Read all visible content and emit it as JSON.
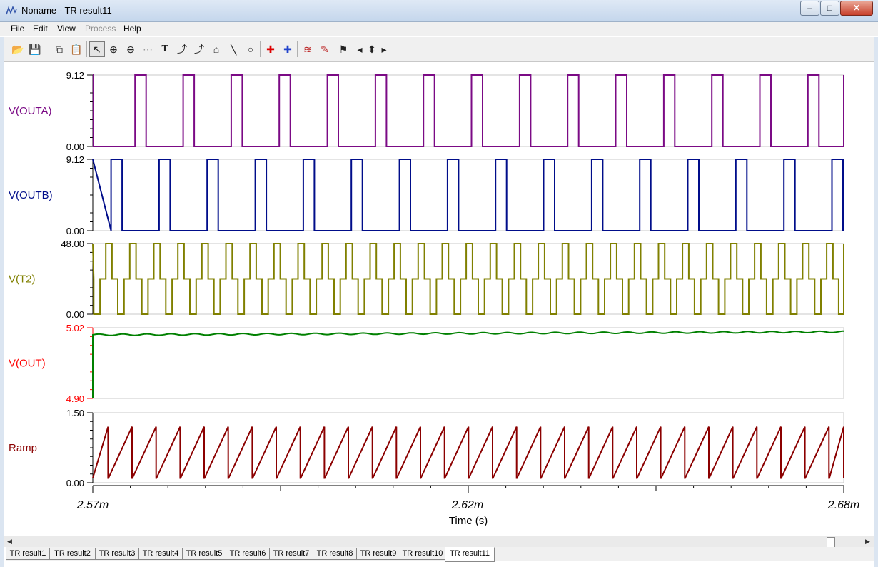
{
  "window": {
    "title": "Noname - TR result11",
    "minimize_glyph": "–",
    "maximize_glyph": "□",
    "close_glyph": "✕"
  },
  "menu": [
    {
      "label": "File",
      "enabled": true
    },
    {
      "label": "Edit",
      "enabled": true
    },
    {
      "label": "View",
      "enabled": true
    },
    {
      "label": "Process",
      "enabled": false
    },
    {
      "label": "Help",
      "enabled": true
    }
  ],
  "toolbar": {
    "buttons": [
      {
        "name": "open-folder-icon",
        "glyph": "📂"
      },
      {
        "name": "save-icon",
        "glyph": "💾"
      },
      {
        "name": "copy-icon",
        "glyph": "⧉"
      },
      {
        "name": "paste-icon",
        "glyph": "📋"
      },
      {
        "name": "pointer-icon",
        "glyph": "↖",
        "active": true
      },
      {
        "name": "zoom-in-icon",
        "glyph": "⊕"
      },
      {
        "name": "zoom-reset-icon",
        "glyph": "⊖"
      },
      {
        "name": "grid-icon",
        "glyph": "⋯"
      },
      {
        "name": "text-tool-icon",
        "glyph": "T"
      },
      {
        "name": "curve-tool-icon",
        "glyph": "⤴"
      },
      {
        "name": "curve-label-icon",
        "glyph": "⤴"
      },
      {
        "name": "house-icon",
        "glyph": "⌂"
      },
      {
        "name": "line-tool-icon",
        "glyph": "╲"
      },
      {
        "name": "circle-tool-icon",
        "glyph": "○"
      },
      {
        "name": "cursor-a-icon",
        "glyph": "✚"
      },
      {
        "name": "cursor-b-icon",
        "glyph": "✚"
      },
      {
        "name": "curves-icon",
        "glyph": "≋"
      },
      {
        "name": "probe-icon",
        "glyph": "✎"
      },
      {
        "name": "flag-icon",
        "glyph": "⚑"
      },
      {
        "name": "move-left-icon",
        "glyph": "◂"
      },
      {
        "name": "move-updown-icon",
        "glyph": "⬍"
      },
      {
        "name": "move-right-icon",
        "glyph": "▸"
      }
    ]
  },
  "chart_data": {
    "type": "line",
    "xlabel": "Time (s)",
    "x_ticks": [
      "2.57m",
      "2.62m",
      "2.68m"
    ],
    "xlim": [
      0.00257,
      0.00267
    ],
    "period_s": 6.4e-06,
    "panels": [
      {
        "name": "V(OUTA)",
        "color": "#7b0a85",
        "ylim": [
          0,
          9.12
        ],
        "y_ticks": [
          "9.12",
          "0.00"
        ],
        "waveform": "pulse",
        "high": 9.12,
        "low": 0,
        "pulse_width_fraction": 0.23,
        "first_high_start_fraction": 0.0,
        "comment": "square pulses"
      },
      {
        "name": "V(OUTB)",
        "color": "#000d8a",
        "ylim": [
          0,
          9.12
        ],
        "y_ticks": [
          "9.12",
          "0.00"
        ],
        "waveform": "pulse",
        "high": 9.12,
        "low": 0,
        "pulse_width_fraction": 0.23,
        "first_high_start_fraction": 0.5
      },
      {
        "name": "V(T2)",
        "color": "#808000",
        "ylim": [
          0,
          48
        ],
        "y_ticks": [
          "48.00",
          "0.00"
        ],
        "waveform": "bridge",
        "high": 48,
        "mid": 24,
        "low": 0
      },
      {
        "name": "V(OUT)",
        "color": "#008000",
        "label_color": "#ff0000",
        "ylim": [
          4.9,
          5.02
        ],
        "y_ticks": [
          "5.02",
          "4.90"
        ],
        "waveform": "ripple",
        "start": 5.008,
        "end": 5.013,
        "ripple": 0.0012
      },
      {
        "name": "Ramp",
        "color": "#8b0000",
        "label_color": "#8b0000",
        "ylim": [
          0,
          1.5
        ],
        "y_ticks": [
          "1.50",
          "0.00"
        ],
        "waveform": "sawtooth",
        "min": 0.1,
        "max": 1.2
      }
    ]
  },
  "tabs": [
    "TR result1",
    "TR result2",
    "TR result3",
    "TR result4",
    "TR result5",
    "TR result6",
    "TR result7",
    "TR result8",
    "TR result9",
    "TR result10",
    "TR result11"
  ],
  "active_tab": "TR result11"
}
